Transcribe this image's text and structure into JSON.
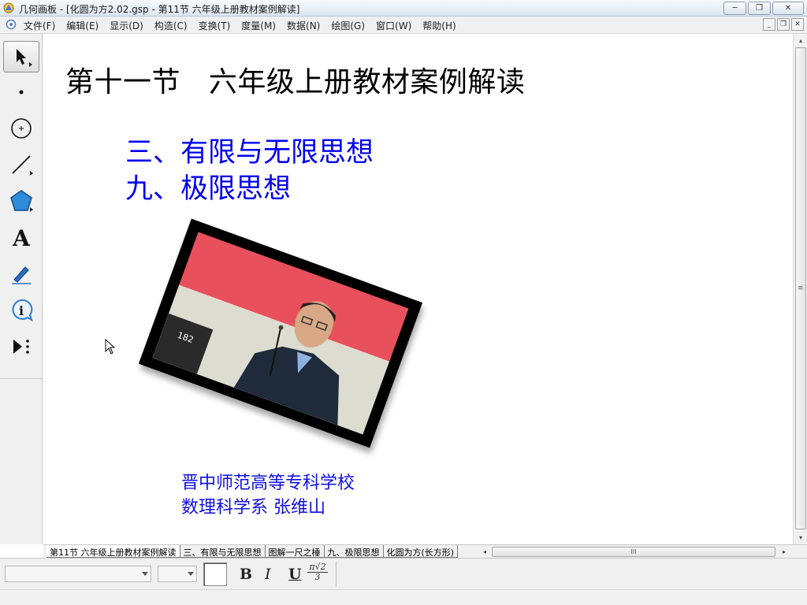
{
  "window": {
    "title": "几何画板 - [化圆为方2.02.gsp - 第11节 六年级上册教材案例解读]",
    "minimize": "─",
    "maximize": "❐",
    "close": "✕"
  },
  "menu": {
    "items": [
      "文件(F)",
      "编辑(E)",
      "显示(D)",
      "构造(C)",
      "变换(T)",
      "度量(M)",
      "数据(N)",
      "绘图(G)",
      "窗口(W)",
      "帮助(H)"
    ],
    "doc_minimize": "_",
    "doc_restore": "❐",
    "doc_close": "✕"
  },
  "toolbox": {
    "tools": [
      "select-arrow-icon",
      "point-icon",
      "compass-icon",
      "straightedge-icon",
      "polygon-icon",
      "text-icon",
      "marker-icon",
      "information-icon",
      "custom-tools-icon"
    ],
    "text_tool_glyph": "A"
  },
  "canvas": {
    "title": "第十一节   六年级上册教材案例解读",
    "headings": [
      "三、有限与无限思想",
      "九、极限思想"
    ],
    "photo_caption": "182",
    "author_lines": [
      "晋中师范高等专科学校",
      "数理科学系  张维山"
    ]
  },
  "page_tabs": [
    "第11节 六年级上册教材案例解读",
    "三、有限与无限思想",
    "图解一尺之棰",
    "九、极限思想",
    "化圆为方(长方形)"
  ],
  "scroll": {
    "left_arrow": "◂",
    "right_arrow": "▸",
    "up_arrow": "▴",
    "down_arrow": "▾",
    "grip": "≡",
    "hgrip": "III"
  },
  "text_toolbar": {
    "bold": "B",
    "italic": "I",
    "underline": "U",
    "math_top": "π√2",
    "math_bottom": "3"
  },
  "colors": {
    "heading_blue": "#0000ee",
    "author_blue": "#1010e0",
    "photo_backdrop_red": "#e8505c"
  }
}
